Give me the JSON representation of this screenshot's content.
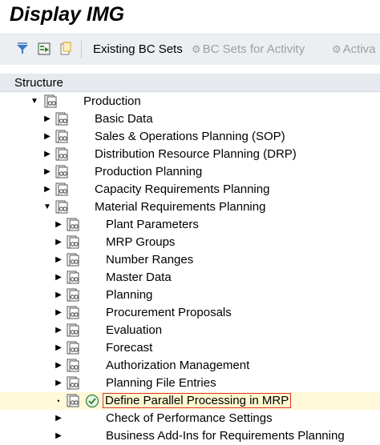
{
  "window": {
    "title": "Display IMG"
  },
  "toolbar": {
    "icons": [
      "filter-icon",
      "execute-icon",
      "copy-icon"
    ],
    "existing_bc_sets": "Existing BC Sets",
    "bc_sets_for_activity": "BC Sets for Activity",
    "activate_trunc": "Activa"
  },
  "structure": {
    "header": "Structure"
  },
  "tree": {
    "root": "Production",
    "level1": [
      "Basic Data",
      "Sales & Operations Planning (SOP)",
      "Distribution Resource Planning (DRP)",
      "Production Planning",
      "Capacity Requirements Planning",
      "Material Requirements Planning"
    ],
    "mrp_children": [
      "Plant Parameters",
      "MRP Groups",
      "Number Ranges",
      "Master Data",
      "Planning",
      "Procurement Proposals",
      "Evaluation",
      "Forecast",
      "Authorization Management",
      "Planning File Entries"
    ],
    "selected_activity": "Define Parallel Processing in MRP",
    "after_selected": [
      "Check of Performance Settings",
      "Business Add-Ins for Requirements Planning"
    ]
  }
}
